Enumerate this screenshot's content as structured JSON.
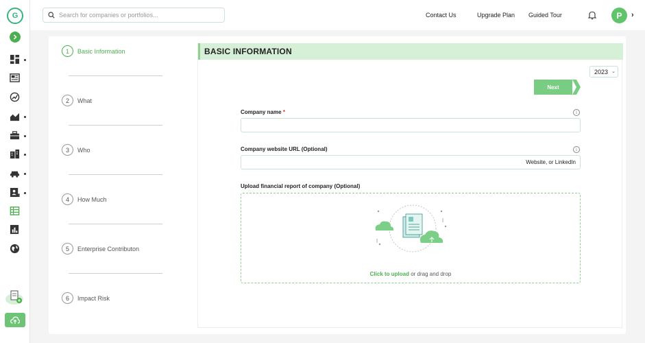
{
  "search": {
    "placeholder": "Search for companies or portfolios..."
  },
  "header": {
    "contact_label": "Contact Us",
    "upgrade_label": "Upgrade Plan",
    "tour_label": "Guided Tour",
    "avatar_initial": "P"
  },
  "brand": {
    "accent": "#4caf50",
    "panel_header_bg": "#d6efd7"
  },
  "stepper": {
    "steps": [
      {
        "num": "1",
        "label": "Basic Information"
      },
      {
        "num": "2",
        "label": "What"
      },
      {
        "num": "3",
        "label": "Who"
      },
      {
        "num": "4",
        "label": "How Much"
      },
      {
        "num": "5",
        "label": "Enterprise Contributon"
      },
      {
        "num": "6",
        "label": "Impact Risk"
      }
    ]
  },
  "form": {
    "title": "BASIC INFORMATION",
    "year": "2023",
    "next_label": "Next",
    "company_name_label": "Company name",
    "required_mark": "*",
    "website_label": "Company website URL (Optional)",
    "website_placeholder": "Website, or LinkedIn",
    "upload_label": "Upload financial report of company (Optional)",
    "upload_link": "Click to upload",
    "upload_rest": " or drag and drop",
    "info_glyph": "i"
  },
  "icons": {
    "sidebar": [
      "dashboard-icon",
      "news-icon",
      "leaf-chart-icon",
      "area-chart-icon",
      "briefcase-icon",
      "buildings-icon",
      "car-icon",
      "user-card-icon",
      "table-icon",
      "report-icon",
      "globe-icon"
    ]
  }
}
